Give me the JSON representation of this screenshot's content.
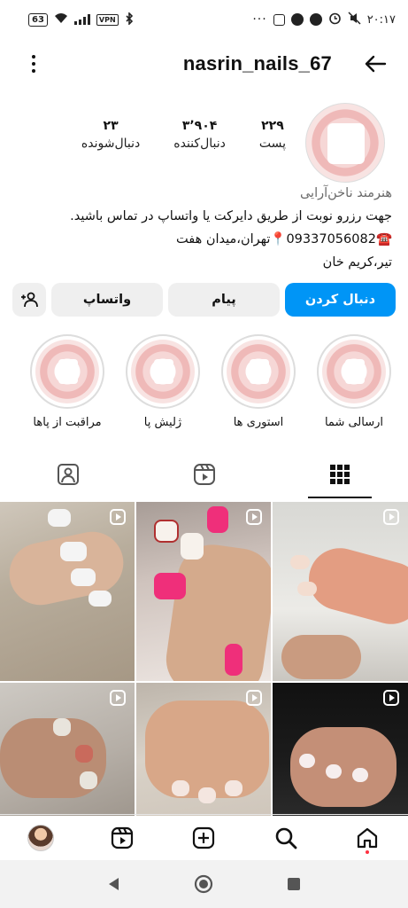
{
  "status_bar": {
    "battery": "63",
    "vpn": "VPN",
    "time": "۲۰:۱۷",
    "dots": "···"
  },
  "header": {
    "username": "nasrin_nails_67"
  },
  "profile": {
    "stats": [
      {
        "number": "۲۲۹",
        "label": "پست"
      },
      {
        "number": "۳٬۹۰۴",
        "label": "دنبال‌کننده"
      },
      {
        "number": "۲۳",
        "label": "دنبال‌شونده"
      }
    ],
    "category": "هنرمند ناخن‌آرایی",
    "bio_line1": "جهت رزرو نوبت از طریق دایرکت یا واتساپ در تماس باشید.",
    "phone_icon": "☎️",
    "phone": "09337056082",
    "pin_icon": "📍",
    "address_line1": "تهران،میدان هفت",
    "address_line2": "تیر،کریم خان"
  },
  "buttons": {
    "follow": "دنبال کردن",
    "message": "پیام",
    "whatsapp": "واتساپ"
  },
  "highlights": [
    {
      "label": "ارسالی شما"
    },
    {
      "label": "استوری ها"
    },
    {
      "label": "ژلیش پا"
    },
    {
      "label": "مراقبت از پاها"
    }
  ],
  "colors": {
    "accent": "#0095f6",
    "notification": "#ff3040"
  }
}
